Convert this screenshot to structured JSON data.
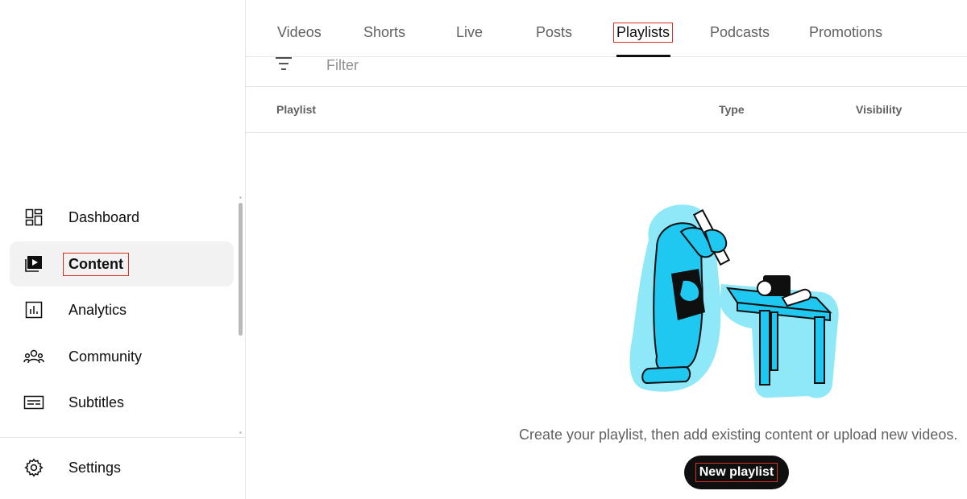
{
  "sidebar": {
    "items": [
      {
        "label": "Dashboard",
        "icon": "dashboard-icon"
      },
      {
        "label": "Content",
        "icon": "content-icon",
        "active": true
      },
      {
        "label": "Analytics",
        "icon": "analytics-icon"
      },
      {
        "label": "Community",
        "icon": "community-icon"
      },
      {
        "label": "Subtitles",
        "icon": "subtitles-icon"
      }
    ],
    "settings": {
      "label": "Settings",
      "icon": "gear-icon"
    }
  },
  "tabs": [
    {
      "label": "Videos"
    },
    {
      "label": "Shorts"
    },
    {
      "label": "Live"
    },
    {
      "label": "Posts"
    },
    {
      "label": "Playlists",
      "active": true
    },
    {
      "label": "Podcasts"
    },
    {
      "label": "Promotions"
    }
  ],
  "filter": {
    "placeholder": "Filter",
    "icon": "filter-icon"
  },
  "table": {
    "columns": [
      "Playlist",
      "Type",
      "Visibility"
    ]
  },
  "empty_state": {
    "message": "Create your playlist, then add existing content or upload new videos.",
    "button_label": "New playlist"
  },
  "colors": {
    "accent_illustration": "#1ec8f0",
    "illustration_glow": "#8ee8f7",
    "highlight_box": "#d93025",
    "button_bg": "#0f0f0f"
  }
}
